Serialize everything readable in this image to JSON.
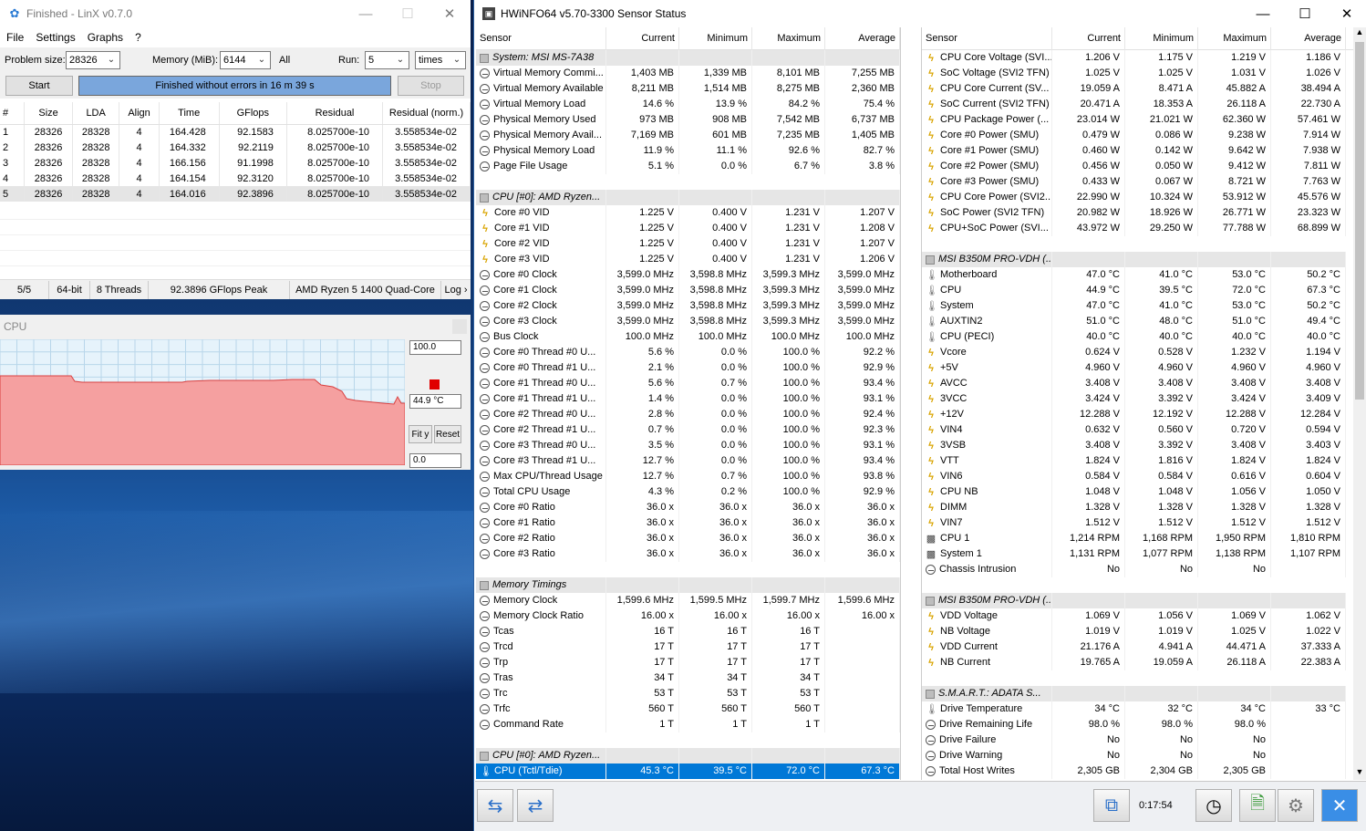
{
  "linx": {
    "title": "Finished - LinX v0.7.0",
    "menu": [
      "File",
      "Settings",
      "Graphs",
      "?"
    ],
    "problem_size_label": "Problem size:",
    "problem_size": "28326",
    "memory_label": "Memory (MiB):",
    "memory": "6144",
    "all_label": "All",
    "run_label": "Run:",
    "run": "5",
    "run_unit": "times",
    "start_label": "Start",
    "status_text": "Finished without errors in 16 m 39 s",
    "stop_label": "Stop",
    "columns": [
      "#",
      "Size",
      "LDA",
      "Align",
      "Time",
      "GFlops",
      "Residual",
      "Residual (norm.)"
    ],
    "rows": [
      [
        "1",
        "28326",
        "28328",
        "4",
        "164.428",
        "92.1583",
        "8.025700e-10",
        "3.558534e-02"
      ],
      [
        "2",
        "28326",
        "28328",
        "4",
        "164.332",
        "92.2119",
        "8.025700e-10",
        "3.558534e-02"
      ],
      [
        "3",
        "28326",
        "28328",
        "4",
        "166.156",
        "91.1998",
        "8.025700e-10",
        "3.558534e-02"
      ],
      [
        "4",
        "28326",
        "28328",
        "4",
        "164.154",
        "92.3120",
        "8.025700e-10",
        "3.558534e-02"
      ],
      [
        "5",
        "28326",
        "28328",
        "4",
        "164.016",
        "92.3896",
        "8.025700e-10",
        "3.558534e-02"
      ]
    ],
    "statusbar": [
      "5/5",
      "64-bit",
      "8 Threads",
      "92.3896 GFlops Peak",
      "AMD Ryzen 5 1400 Quad-Core",
      "Log ›"
    ]
  },
  "cpu_graph": {
    "title": "CPU",
    "max": "100.0",
    "current": "44.9 °C",
    "min": "0.0",
    "fit_label": "Fit y",
    "reset_label": "Reset",
    "marker_color": "#e00000",
    "trace": [
      [
        0,
        67
      ],
      [
        78,
        67
      ],
      [
        82,
        73
      ],
      [
        90,
        74
      ],
      [
        150,
        74
      ],
      [
        200,
        74
      ],
      [
        205,
        73
      ],
      [
        230,
        72
      ],
      [
        300,
        72
      ],
      [
        320,
        71
      ],
      [
        345,
        71
      ],
      [
        352,
        77
      ],
      [
        365,
        79
      ],
      [
        375,
        84
      ],
      [
        380,
        92
      ],
      [
        390,
        94
      ],
      [
        400,
        95
      ],
      [
        420,
        97
      ],
      [
        432,
        98
      ],
      [
        436,
        90
      ],
      [
        440,
        97
      ],
      [
        444,
        97
      ]
    ]
  },
  "hwinfo": {
    "title": "HWiNFO64 v5.70-3300 Sensor Status",
    "elapsed": "0:17:54",
    "columns": [
      "Sensor",
      "Current",
      "Minimum",
      "Maximum",
      "Average"
    ],
    "left": [
      {
        "g": "System: MSI MS-7A38"
      },
      {
        "i": "clock",
        "n": "Virtual Memory Commi...",
        "v": [
          "1,403 MB",
          "1,339 MB",
          "8,101 MB",
          "7,255 MB"
        ]
      },
      {
        "i": "clock",
        "n": "Virtual Memory Available",
        "v": [
          "8,211 MB",
          "1,514 MB",
          "8,275 MB",
          "2,360 MB"
        ]
      },
      {
        "i": "clock",
        "n": "Virtual Memory Load",
        "v": [
          "14.6 %",
          "13.9 %",
          "84.2 %",
          "75.4 %"
        ]
      },
      {
        "i": "clock",
        "n": "Physical Memory Used",
        "v": [
          "973 MB",
          "908 MB",
          "7,542 MB",
          "6,737 MB"
        ]
      },
      {
        "i": "clock",
        "n": "Physical Memory Avail...",
        "v": [
          "7,169 MB",
          "601 MB",
          "7,235 MB",
          "1,405 MB"
        ]
      },
      {
        "i": "clock",
        "n": "Physical Memory Load",
        "v": [
          "11.9 %",
          "11.1 %",
          "92.6 %",
          "82.7 %"
        ]
      },
      {
        "i": "clock",
        "n": "Page File Usage",
        "v": [
          "5.1 %",
          "0.0 %",
          "6.7 %",
          "3.8 %"
        ]
      },
      {
        "e": 1
      },
      {
        "g": "CPU [#0]: AMD Ryzen..."
      },
      {
        "i": "bolt",
        "n": "Core #0 VID",
        "v": [
          "1.225 V",
          "0.400 V",
          "1.231 V",
          "1.207 V"
        ]
      },
      {
        "i": "bolt",
        "n": "Core #1 VID",
        "v": [
          "1.225 V",
          "0.400 V",
          "1.231 V",
          "1.208 V"
        ]
      },
      {
        "i": "bolt",
        "n": "Core #2 VID",
        "v": [
          "1.225 V",
          "0.400 V",
          "1.231 V",
          "1.207 V"
        ]
      },
      {
        "i": "bolt",
        "n": "Core #3 VID",
        "v": [
          "1.225 V",
          "0.400 V",
          "1.231 V",
          "1.206 V"
        ]
      },
      {
        "i": "clock",
        "n": "Core #0 Clock",
        "v": [
          "3,599.0 MHz",
          "3,598.8 MHz",
          "3,599.3 MHz",
          "3,599.0 MHz"
        ]
      },
      {
        "i": "clock",
        "n": "Core #1 Clock",
        "v": [
          "3,599.0 MHz",
          "3,598.8 MHz",
          "3,599.3 MHz",
          "3,599.0 MHz"
        ]
      },
      {
        "i": "clock",
        "n": "Core #2 Clock",
        "v": [
          "3,599.0 MHz",
          "3,598.8 MHz",
          "3,599.3 MHz",
          "3,599.0 MHz"
        ]
      },
      {
        "i": "clock",
        "n": "Core #3 Clock",
        "v": [
          "3,599.0 MHz",
          "3,598.8 MHz",
          "3,599.3 MHz",
          "3,599.0 MHz"
        ]
      },
      {
        "i": "clock",
        "n": "Bus Clock",
        "v": [
          "100.0 MHz",
          "100.0 MHz",
          "100.0 MHz",
          "100.0 MHz"
        ]
      },
      {
        "i": "clock",
        "n": "Core #0 Thread #0 U...",
        "v": [
          "5.6 %",
          "0.0 %",
          "100.0 %",
          "92.2 %"
        ]
      },
      {
        "i": "clock",
        "n": "Core #0 Thread #1 U...",
        "v": [
          "2.1 %",
          "0.0 %",
          "100.0 %",
          "92.9 %"
        ]
      },
      {
        "i": "clock",
        "n": "Core #1 Thread #0 U...",
        "v": [
          "5.6 %",
          "0.7 %",
          "100.0 %",
          "93.4 %"
        ]
      },
      {
        "i": "clock",
        "n": "Core #1 Thread #1 U...",
        "v": [
          "1.4 %",
          "0.0 %",
          "100.0 %",
          "93.1 %"
        ]
      },
      {
        "i": "clock",
        "n": "Core #2 Thread #0 U...",
        "v": [
          "2.8 %",
          "0.0 %",
          "100.0 %",
          "92.4 %"
        ]
      },
      {
        "i": "clock",
        "n": "Core #2 Thread #1 U...",
        "v": [
          "0.7 %",
          "0.0 %",
          "100.0 %",
          "92.3 %"
        ]
      },
      {
        "i": "clock",
        "n": "Core #3 Thread #0 U...",
        "v": [
          "3.5 %",
          "0.0 %",
          "100.0 %",
          "93.1 %"
        ]
      },
      {
        "i": "clock",
        "n": "Core #3 Thread #1 U...",
        "v": [
          "12.7 %",
          "0.0 %",
          "100.0 %",
          "93.4 %"
        ]
      },
      {
        "i": "clock",
        "n": "Max CPU/Thread Usage",
        "v": [
          "12.7 %",
          "0.7 %",
          "100.0 %",
          "93.8 %"
        ]
      },
      {
        "i": "clock",
        "n": "Total CPU Usage",
        "v": [
          "4.3 %",
          "0.2 %",
          "100.0 %",
          "92.9 %"
        ]
      },
      {
        "i": "clock",
        "n": "Core #0 Ratio",
        "v": [
          "36.0 x",
          "36.0 x",
          "36.0 x",
          "36.0 x"
        ]
      },
      {
        "i": "clock",
        "n": "Core #1 Ratio",
        "v": [
          "36.0 x",
          "36.0 x",
          "36.0 x",
          "36.0 x"
        ]
      },
      {
        "i": "clock",
        "n": "Core #2 Ratio",
        "v": [
          "36.0 x",
          "36.0 x",
          "36.0 x",
          "36.0 x"
        ]
      },
      {
        "i": "clock",
        "n": "Core #3 Ratio",
        "v": [
          "36.0 x",
          "36.0 x",
          "36.0 x",
          "36.0 x"
        ]
      },
      {
        "e": 1
      },
      {
        "g": "Memory Timings"
      },
      {
        "i": "clock",
        "n": "Memory Clock",
        "v": [
          "1,599.6 MHz",
          "1,599.5 MHz",
          "1,599.7 MHz",
          "1,599.6 MHz"
        ]
      },
      {
        "i": "clock",
        "n": "Memory Clock Ratio",
        "v": [
          "16.00 x",
          "16.00 x",
          "16.00 x",
          "16.00 x"
        ]
      },
      {
        "i": "clock",
        "n": "Tcas",
        "v": [
          "16 T",
          "16 T",
          "16 T",
          ""
        ]
      },
      {
        "i": "clock",
        "n": "Trcd",
        "v": [
          "17 T",
          "17 T",
          "17 T",
          ""
        ]
      },
      {
        "i": "clock",
        "n": "Trp",
        "v": [
          "17 T",
          "17 T",
          "17 T",
          ""
        ]
      },
      {
        "i": "clock",
        "n": "Tras",
        "v": [
          "34 T",
          "34 T",
          "34 T",
          ""
        ]
      },
      {
        "i": "clock",
        "n": "Trc",
        "v": [
          "53 T",
          "53 T",
          "53 T",
          ""
        ]
      },
      {
        "i": "clock",
        "n": "Trfc",
        "v": [
          "560 T",
          "560 T",
          "560 T",
          ""
        ]
      },
      {
        "i": "clock",
        "n": "Command Rate",
        "v": [
          "1 T",
          "1 T",
          "1 T",
          ""
        ]
      },
      {
        "e": 1
      },
      {
        "g": "CPU [#0]: AMD Ryzen..."
      },
      {
        "i": "therm",
        "n": "CPU (Tctl/Tdie)",
        "v": [
          "45.3 °C",
          "39.5 °C",
          "72.0 °C",
          "67.3 °C"
        ],
        "sel": 1
      }
    ],
    "right": [
      {
        "i": "bolt",
        "n": "CPU Core Voltage (SVI...",
        "v": [
          "1.206 V",
          "1.175 V",
          "1.219 V",
          "1.186 V"
        ]
      },
      {
        "i": "bolt",
        "n": "SoC Voltage (SVI2 TFN)",
        "v": [
          "1.025 V",
          "1.025 V",
          "1.031 V",
          "1.026 V"
        ]
      },
      {
        "i": "bolt",
        "n": "CPU Core Current (SV...",
        "v": [
          "19.059 A",
          "8.471 A",
          "45.882 A",
          "38.494 A"
        ]
      },
      {
        "i": "bolt",
        "n": "SoC Current (SVI2 TFN)",
        "v": [
          "20.471 A",
          "18.353 A",
          "26.118 A",
          "22.730 A"
        ]
      },
      {
        "i": "bolt",
        "n": "CPU Package Power (...",
        "v": [
          "23.014 W",
          "21.021 W",
          "62.360 W",
          "57.461 W"
        ]
      },
      {
        "i": "bolt",
        "n": "Core #0 Power (SMU)",
        "v": [
          "0.479 W",
          "0.086 W",
          "9.238 W",
          "7.914 W"
        ]
      },
      {
        "i": "bolt",
        "n": "Core #1 Power (SMU)",
        "v": [
          "0.460 W",
          "0.142 W",
          "9.642 W",
          "7.938 W"
        ]
      },
      {
        "i": "bolt",
        "n": "Core #2 Power (SMU)",
        "v": [
          "0.456 W",
          "0.050 W",
          "9.412 W",
          "7.811 W"
        ]
      },
      {
        "i": "bolt",
        "n": "Core #3 Power (SMU)",
        "v": [
          "0.433 W",
          "0.067 W",
          "8.721 W",
          "7.763 W"
        ]
      },
      {
        "i": "bolt",
        "n": "CPU Core Power (SVI2...",
        "v": [
          "22.990 W",
          "10.324 W",
          "53.912 W",
          "45.576 W"
        ]
      },
      {
        "i": "bolt",
        "n": "SoC Power (SVI2 TFN)",
        "v": [
          "20.982 W",
          "18.926 W",
          "26.771 W",
          "23.323 W"
        ]
      },
      {
        "i": "bolt",
        "n": "CPU+SoC Power (SVI...",
        "v": [
          "43.972 W",
          "29.250 W",
          "77.788 W",
          "68.899 W"
        ]
      },
      {
        "e": 1
      },
      {
        "g": "MSI B350M PRO-VDH (..."
      },
      {
        "i": "therm",
        "n": "Motherboard",
        "v": [
          "47.0 °C",
          "41.0 °C",
          "53.0 °C",
          "50.2 °C"
        ]
      },
      {
        "i": "therm",
        "n": "CPU",
        "v": [
          "44.9 °C",
          "39.5 °C",
          "72.0 °C",
          "67.3 °C"
        ]
      },
      {
        "i": "therm",
        "n": "System",
        "v": [
          "47.0 °C",
          "41.0 °C",
          "53.0 °C",
          "50.2 °C"
        ]
      },
      {
        "i": "therm",
        "n": "AUXTIN2",
        "v": [
          "51.0 °C",
          "48.0 °C",
          "51.0 °C",
          "49.4 °C"
        ]
      },
      {
        "i": "therm",
        "n": "CPU (PECI)",
        "v": [
          "40.0 °C",
          "40.0 °C",
          "40.0 °C",
          "40.0 °C"
        ]
      },
      {
        "i": "bolt",
        "n": "Vcore",
        "v": [
          "0.624 V",
          "0.528 V",
          "1.232 V",
          "1.194 V"
        ]
      },
      {
        "i": "bolt",
        "n": "+5V",
        "v": [
          "4.960 V",
          "4.960 V",
          "4.960 V",
          "4.960 V"
        ]
      },
      {
        "i": "bolt",
        "n": "AVCC",
        "v": [
          "3.408 V",
          "3.408 V",
          "3.408 V",
          "3.408 V"
        ]
      },
      {
        "i": "bolt",
        "n": "3VCC",
        "v": [
          "3.424 V",
          "3.392 V",
          "3.424 V",
          "3.409 V"
        ]
      },
      {
        "i": "bolt",
        "n": "+12V",
        "v": [
          "12.288 V",
          "12.192 V",
          "12.288 V",
          "12.284 V"
        ]
      },
      {
        "i": "bolt",
        "n": "VIN4",
        "v": [
          "0.632 V",
          "0.560 V",
          "0.720 V",
          "0.594 V"
        ]
      },
      {
        "i": "bolt",
        "n": "3VSB",
        "v": [
          "3.408 V",
          "3.392 V",
          "3.408 V",
          "3.403 V"
        ]
      },
      {
        "i": "bolt",
        "n": "VTT",
        "v": [
          "1.824 V",
          "1.816 V",
          "1.824 V",
          "1.824 V"
        ]
      },
      {
        "i": "bolt",
        "n": "VIN6",
        "v": [
          "0.584 V",
          "0.584 V",
          "0.616 V",
          "0.604 V"
        ]
      },
      {
        "i": "bolt",
        "n": "CPU NB",
        "v": [
          "1.048 V",
          "1.048 V",
          "1.056 V",
          "1.050 V"
        ]
      },
      {
        "i": "bolt",
        "n": "DIMM",
        "v": [
          "1.328 V",
          "1.328 V",
          "1.328 V",
          "1.328 V"
        ]
      },
      {
        "i": "bolt",
        "n": "VIN7",
        "v": [
          "1.512 V",
          "1.512 V",
          "1.512 V",
          "1.512 V"
        ]
      },
      {
        "i": "fan",
        "n": "CPU 1",
        "v": [
          "1,214 RPM",
          "1,168 RPM",
          "1,950 RPM",
          "1,810 RPM"
        ]
      },
      {
        "i": "fan",
        "n": "System 1",
        "v": [
          "1,131 RPM",
          "1,077 RPM",
          "1,138 RPM",
          "1,107 RPM"
        ]
      },
      {
        "i": "clock",
        "n": "Chassis Intrusion",
        "v": [
          "No",
          "No",
          "No",
          ""
        ]
      },
      {
        "e": 1
      },
      {
        "g": "MSI B350M PRO-VDH (..."
      },
      {
        "i": "bolt",
        "n": "VDD Voltage",
        "v": [
          "1.069 V",
          "1.056 V",
          "1.069 V",
          "1.062 V"
        ]
      },
      {
        "i": "bolt",
        "n": "NB Voltage",
        "v": [
          "1.019 V",
          "1.019 V",
          "1.025 V",
          "1.022 V"
        ]
      },
      {
        "i": "bolt",
        "n": "VDD Current",
        "v": [
          "21.176 A",
          "4.941 A",
          "44.471 A",
          "37.333 A"
        ]
      },
      {
        "i": "bolt",
        "n": "NB Current",
        "v": [
          "19.765 A",
          "19.059 A",
          "26.118 A",
          "22.383 A"
        ]
      },
      {
        "e": 1
      },
      {
        "g": "S.M.A.R.T.: ADATA S..."
      },
      {
        "i": "therm",
        "n": "Drive Temperature",
        "v": [
          "34 °C",
          "32 °C",
          "34 °C",
          "33 °C"
        ]
      },
      {
        "i": "clock",
        "n": "Drive Remaining Life",
        "v": [
          "98.0 %",
          "98.0 %",
          "98.0 %",
          ""
        ]
      },
      {
        "i": "clock",
        "n": "Drive Failure",
        "v": [
          "No",
          "No",
          "No",
          ""
        ]
      },
      {
        "i": "clock",
        "n": "Drive Warning",
        "v": [
          "No",
          "No",
          "No",
          ""
        ]
      },
      {
        "i": "clock",
        "n": "Total Host Writes",
        "v": [
          "2,305 GB",
          "2,304 GB",
          "2,305 GB",
          ""
        ]
      }
    ]
  }
}
